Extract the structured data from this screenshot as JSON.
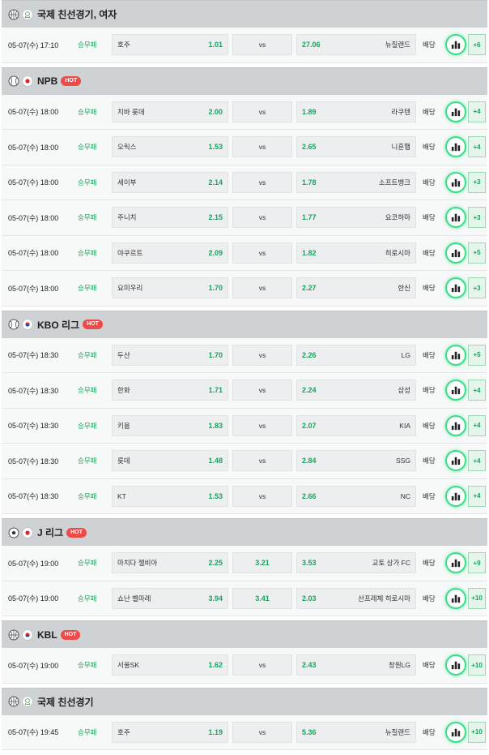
{
  "labels": {
    "bet": "배당",
    "vs": "vs",
    "hot": "HOT"
  },
  "colors": {
    "accent": "#1aa35e",
    "header": "#cfd2d5",
    "hot": "#ef4a4a"
  },
  "leagues": [
    {
      "name": "국제 친선경기, 여자",
      "sport": "basketball",
      "flag": "world",
      "hot": false,
      "matches": [
        {
          "time": "05-07(수) 17:10",
          "market": "승무패",
          "home": "호주",
          "home_odds": "1.01",
          "draw": "vs",
          "away": "뉴질랜드",
          "away_odds": "27.06",
          "more": "+6"
        }
      ]
    },
    {
      "name": "NPB",
      "sport": "baseball",
      "flag": "japan",
      "hot": true,
      "matches": [
        {
          "time": "05-07(수) 18:00",
          "market": "승무패",
          "home": "치바 롯데",
          "home_odds": "2.00",
          "draw": "vs",
          "away": "라쿠텐",
          "away_odds": "1.89",
          "more": "+4"
        },
        {
          "time": "05-07(수) 18:00",
          "market": "승무패",
          "home": "오릭스",
          "home_odds": "1.53",
          "draw": "vs",
          "away": "니혼햄",
          "away_odds": "2.65",
          "more": "+4"
        },
        {
          "time": "05-07(수) 18:00",
          "market": "승무패",
          "home": "세이부",
          "home_odds": "2.14",
          "draw": "vs",
          "away": "소프트뱅크",
          "away_odds": "1.78",
          "more": "+3"
        },
        {
          "time": "05-07(수) 18:00",
          "market": "승무패",
          "home": "주니치",
          "home_odds": "2.15",
          "draw": "vs",
          "away": "요코하마",
          "away_odds": "1.77",
          "more": "+3"
        },
        {
          "time": "05-07(수) 18:00",
          "market": "승무패",
          "home": "야쿠르트",
          "home_odds": "2.09",
          "draw": "vs",
          "away": "히로시마",
          "away_odds": "1.82",
          "more": "+5"
        },
        {
          "time": "05-07(수) 18:00",
          "market": "승무패",
          "home": "요미우리",
          "home_odds": "1.70",
          "draw": "vs",
          "away": "한신",
          "away_odds": "2.27",
          "more": "+3"
        }
      ]
    },
    {
      "name": "KBO 리그",
      "sport": "baseball",
      "flag": "korea",
      "hot": true,
      "matches": [
        {
          "time": "05-07(수) 18:30",
          "market": "승무패",
          "home": "두산",
          "home_odds": "1.70",
          "draw": "vs",
          "away": "LG",
          "away_odds": "2.26",
          "more": "+5"
        },
        {
          "time": "05-07(수) 18:30",
          "market": "승무패",
          "home": "한화",
          "home_odds": "1.71",
          "draw": "vs",
          "away": "삼성",
          "away_odds": "2.24",
          "more": "+4"
        },
        {
          "time": "05-07(수) 18:30",
          "market": "승무패",
          "home": "키움",
          "home_odds": "1.83",
          "draw": "vs",
          "away": "KIA",
          "away_odds": "2.07",
          "more": "+4"
        },
        {
          "time": "05-07(수) 18:30",
          "market": "승무패",
          "home": "롯데",
          "home_odds": "1.48",
          "draw": "vs",
          "away": "SSG",
          "away_odds": "2.84",
          "more": "+4"
        },
        {
          "time": "05-07(수) 18:30",
          "market": "승무패",
          "home": "KT",
          "home_odds": "1.53",
          "draw": "vs",
          "away": "NC",
          "away_odds": "2.66",
          "more": "+4"
        }
      ]
    },
    {
      "name": "J 리그",
      "sport": "soccer",
      "flag": "japan",
      "hot": true,
      "matches": [
        {
          "time": "05-07(수) 19:00",
          "market": "승무패",
          "home": "마치다 젤비아",
          "home_odds": "2.25",
          "draw": "3.21",
          "away": "교토 상가 FC",
          "away_odds": "3.53",
          "more": "+9"
        },
        {
          "time": "05-07(수) 19:00",
          "market": "승무패",
          "home": "쇼난 벨마레",
          "home_odds": "3.94",
          "draw": "3.41",
          "away": "산프레체 히로시마",
          "away_odds": "2.03",
          "more": "+10"
        }
      ]
    },
    {
      "name": "KBL",
      "sport": "basketball",
      "flag": "korea",
      "hot": true,
      "matches": [
        {
          "time": "05-07(수) 19:00",
          "market": "승무패",
          "home": "서울SK",
          "home_odds": "1.62",
          "draw": "vs",
          "away": "창원LG",
          "away_odds": "2.43",
          "more": "+10"
        }
      ]
    },
    {
      "name": "국제 친선경기",
      "sport": "basketball",
      "flag": "world",
      "hot": false,
      "matches": [
        {
          "time": "05-07(수) 19:45",
          "market": "승무패",
          "home": "호주",
          "home_odds": "1.19",
          "draw": "vs",
          "away": "뉴질랜드",
          "away_odds": "5.36",
          "more": "+10"
        }
      ]
    }
  ]
}
